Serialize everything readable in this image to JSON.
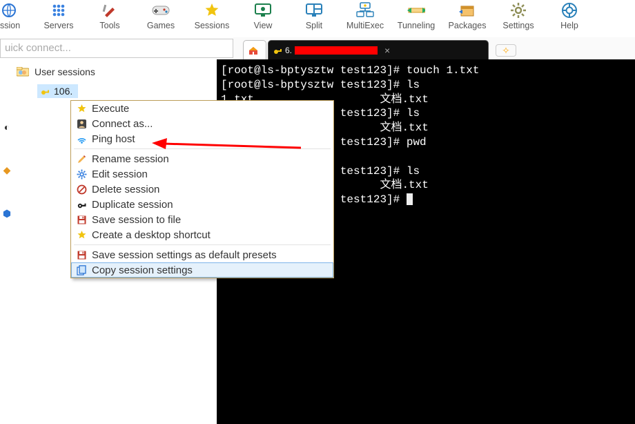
{
  "toolbar": [
    {
      "id": "session",
      "label": "ssion",
      "icon": "globe-icon",
      "color": "#2a74d4"
    },
    {
      "id": "servers",
      "label": "Servers",
      "icon": "dots-icon",
      "color": "#3a82e0"
    },
    {
      "id": "tools",
      "label": "Tools",
      "icon": "knife-icon",
      "color": "#c0392b"
    },
    {
      "id": "games",
      "label": "Games",
      "icon": "gamepad-icon",
      "color": "#7f8c8d"
    },
    {
      "id": "sessions",
      "label": "Sessions",
      "icon": "star-icon",
      "color": "#f1c40f"
    },
    {
      "id": "view",
      "label": "View",
      "icon": "screen-icon",
      "color": "#1b7f4c"
    },
    {
      "id": "split",
      "label": "Split",
      "icon": "split-icon",
      "color": "#2980b9"
    },
    {
      "id": "multiexec",
      "label": "MultiExec",
      "icon": "multiexec-icon",
      "color": "#2980b9"
    },
    {
      "id": "tunneling",
      "label": "Tunneling",
      "icon": "tunnel-icon",
      "color": "#d35400"
    },
    {
      "id": "packages",
      "label": "Packages",
      "icon": "package-icon",
      "color": "#2L74d4"
    },
    {
      "id": "settings",
      "label": "Settings",
      "icon": "gear-icon",
      "color": "#7f8c8d"
    },
    {
      "id": "help",
      "label": "Help",
      "icon": "help-icon",
      "color": "#2980b9"
    }
  ],
  "quick_connect_placeholder": "uick connect...",
  "tabs": {
    "home_label": "",
    "active_prefix": "6.",
    "active_label_censored": true
  },
  "tree": {
    "root_label": "User sessions",
    "selected_label": "106."
  },
  "terminal_lines": [
    "[root@ls-bptysztw test123]# touch 1.txt",
    "[root@ls-bptysztw test123]# ls",
    "文档.txt",
    "w test123]# ls",
    "文档.txt",
    "w test123]# pwd",
    "",
    "w test123]# ls",
    "文档.txt",
    "w test123]# "
  ],
  "terminal_cut_prefix_cols": 0,
  "context_menu": [
    {
      "icon": "star-icon",
      "label": "Execute"
    },
    {
      "icon": "person-icon",
      "label": "Connect as..."
    },
    {
      "icon": "signal-icon",
      "label": "Ping host"
    },
    {
      "sep": true
    },
    {
      "icon": "pencil-icon",
      "label": "Rename session"
    },
    {
      "icon": "gear-icon",
      "label": "Edit session"
    },
    {
      "icon": "trash-icon",
      "label": "Delete session"
    },
    {
      "icon": "key-icon",
      "label": "Duplicate session"
    },
    {
      "icon": "floppy-icon",
      "label": "Save session to file"
    },
    {
      "icon": "star-icon",
      "label": "Create a desktop shortcut"
    },
    {
      "sep": true
    },
    {
      "icon": "floppy-icon",
      "label": "Save session settings as default presets"
    },
    {
      "icon": "copy-icon",
      "label": "Copy session settings",
      "hover": true
    }
  ],
  "arrow_annotation": {
    "points_to": "Ping host"
  }
}
